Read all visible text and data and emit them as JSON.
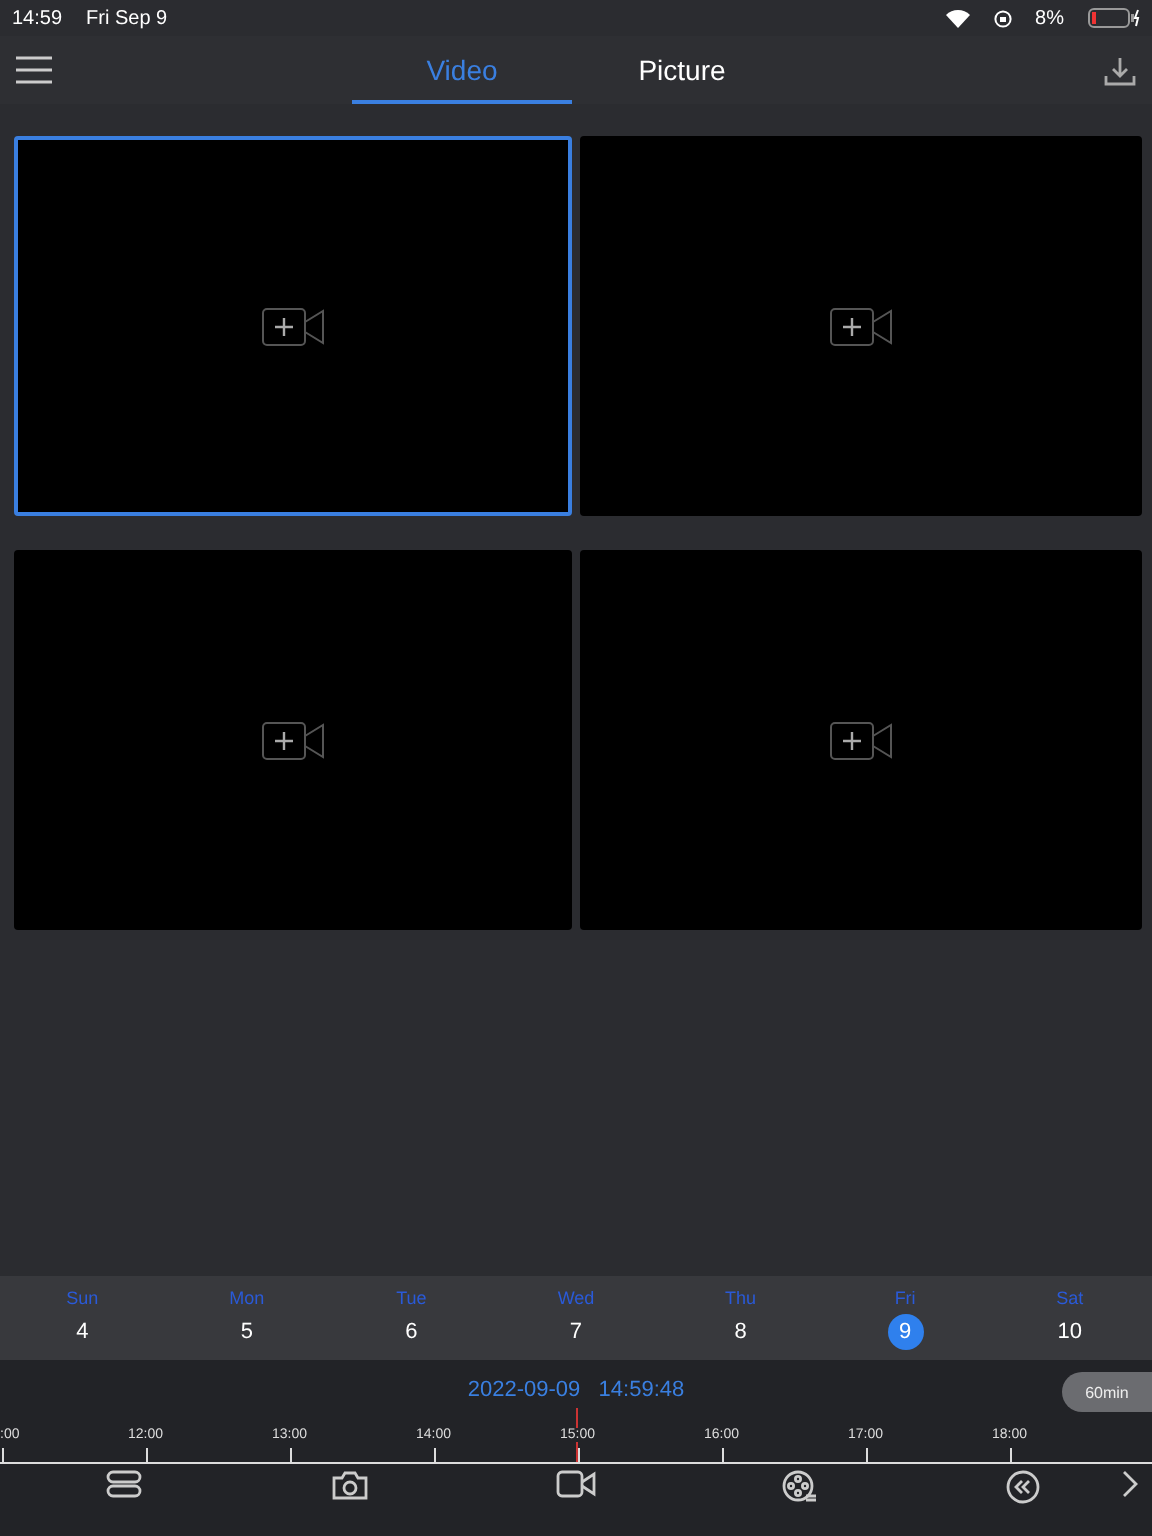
{
  "status_bar": {
    "time": "14:59",
    "date": "Fri Sep 9",
    "battery": "8%"
  },
  "tabs": [
    {
      "label": "Video",
      "selected": true
    },
    {
      "label": "Picture",
      "selected": false
    }
  ],
  "video_windows": [
    {
      "selected": true
    },
    {
      "selected": false
    },
    {
      "selected": false
    },
    {
      "selected": false
    }
  ],
  "calendar": [
    {
      "weekday": "Sun",
      "day": "4",
      "selected": false
    },
    {
      "weekday": "Mon",
      "day": "5",
      "selected": false
    },
    {
      "weekday": "Tue",
      "day": "6",
      "selected": false
    },
    {
      "weekday": "Wed",
      "day": "7",
      "selected": false
    },
    {
      "weekday": "Thu",
      "day": "8",
      "selected": false
    },
    {
      "weekday": "Fri",
      "day": "9",
      "selected": true
    },
    {
      "weekday": "Sat",
      "day": "10",
      "selected": false
    }
  ],
  "timeline": {
    "datetime": "2022-09-09   14:59:48",
    "zoom": "60min",
    "ticks": [
      ":00",
      "12:00",
      "13:00",
      "14:00",
      "15:00",
      "16:00",
      "17:00",
      "18:00"
    ]
  },
  "toolbar": [
    {
      "kind": "layout"
    },
    {
      "kind": "snapshot"
    },
    {
      "kind": "record"
    },
    {
      "kind": "reel"
    },
    {
      "kind": "rewind"
    },
    {
      "kind": "next"
    }
  ]
}
